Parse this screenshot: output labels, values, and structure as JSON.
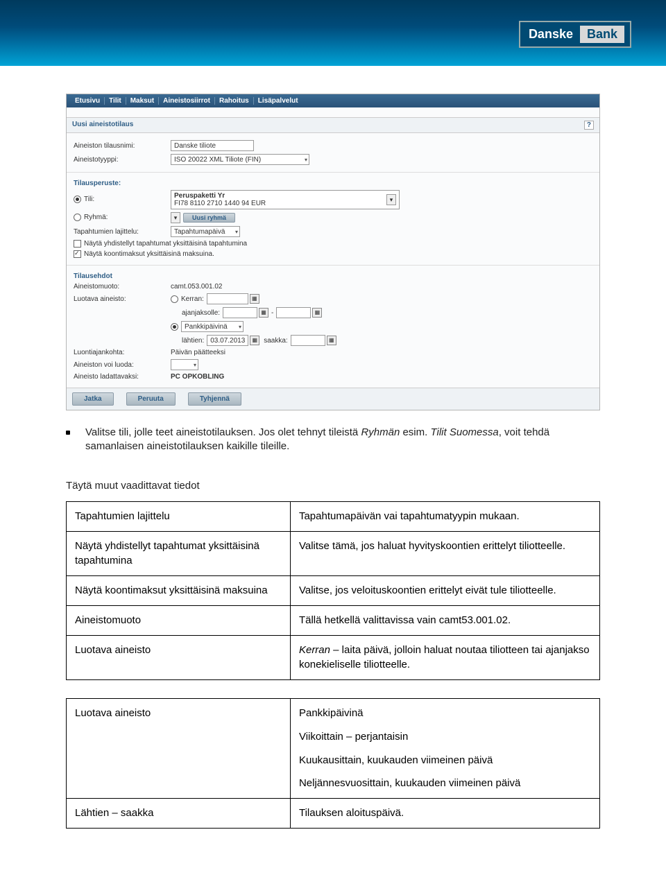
{
  "branding": {
    "danske": "Danske",
    "bank": "Bank"
  },
  "legacy": {
    "menu": [
      "Etusivu",
      "Tilit",
      "Maksut",
      "Aineistosiirrot",
      "Rahoitus",
      "Lisäpalvelut"
    ],
    "section1_title": "Uusi aineistotilaus",
    "help_icon": "?",
    "labels": {
      "tilausnimi": "Aineiston tilausnimi:",
      "tilausnimi_val": "Danske tiliote",
      "tyyppi": "Aineistotyyppi:",
      "tyyppi_val": "ISO 20022 XML Tiliote (FIN)",
      "tilausperuste": "Tilausperuste:",
      "tili": "Tili:",
      "tili_val_line1": "Peruspaketti Yr",
      "tili_val_line2": "FI78 8110 2710 1440 94 EUR",
      "ryhma": "Ryhmä:",
      "uusi_ryhma_btn": "Uusi ryhmä",
      "lajittelu": "Tapahtumien lajittelu:",
      "lajittelu_val": "Tapahtumapäivä",
      "chk1": "Näytä yhdistellyt tapahtumat yksittäisinä tapahtumina",
      "chk2": "Näytä koontimaksut yksittäisinä maksuina.",
      "tilausehdot": "Tilausehdot",
      "muoto": "Aineistomuoto:",
      "muoto_val": "camt.053.001.02",
      "luotava": "Luotava aineisto:",
      "kerran": "Kerran:",
      "ajanjaksolle": "ajanjaksolle:",
      "pankkipaivina": "Pankkipäivinä",
      "lahtien": "lähtien:",
      "lahtien_val": "03.07.2013",
      "saakka": "saakka:",
      "luontiajankohta": "Luontiajankohta:",
      "luontiajankohta_val": "Päivän päätteeksi",
      "voi_luoda": "Aineiston voi luoda:",
      "ladattavaksi": "Aineisto ladattavaksi:",
      "ladattavaksi_val": "PC OPKOBLING",
      "dash": "-"
    },
    "buttons": [
      "Jatka",
      "Peruuta",
      "Tyhjennä"
    ]
  },
  "body": {
    "bullet_pre": "Valitse tili, jolle teet aineistotilauksen. Jos olet tehnyt tileistä ",
    "bullet_italic1": "Ryhmän",
    "bullet_mid": " esim. ",
    "bullet_italic2": "Tilit Suomessa",
    "bullet_post": ", voit tehdä samanlaisen aineistotilauksen kaikille tileille.",
    "section_title": "Täytä muut vaadittavat tiedot"
  },
  "table": {
    "rows": [
      {
        "l": "Tapahtumien lajittelu",
        "r": "Tapahtumapäivän vai tapahtumatyypin mukaan."
      },
      {
        "l": "Näytä yhdistellyt tapahtumat yksittäisinä tapahtumina",
        "r": "Valitse tämä, jos haluat hyvityskoontien erittelyt tiliotteelle."
      },
      {
        "l": "Näytä koontimaksut yksittäisinä maksuina",
        "r": "Valitse, jos veloituskoontien erittelyt eivät tule tiliotteelle."
      },
      {
        "l": "Aineistomuoto",
        "r": "Tällä hetkellä valittavissa vain camt53.001.02."
      }
    ],
    "row5": {
      "l": "Luotava aineisto",
      "r_italic": "Kerran",
      "r_rest": " – laita päivä, jolloin haluat noutaa tiliotteen tai ajanjakso konekieliselle tiliotteelle."
    },
    "row6": {
      "l": "Luotava aineisto",
      "lines": [
        "Pankkipäivinä",
        "Viikoittain – perjantaisin",
        "Kuukausittain, kuukauden viimeinen päivä",
        "Neljännesvuosittain, kuukauden viimeinen päivä"
      ]
    },
    "row7": {
      "l": "Lähtien – saakka",
      "r": "Tilauksen aloituspäivä."
    }
  }
}
